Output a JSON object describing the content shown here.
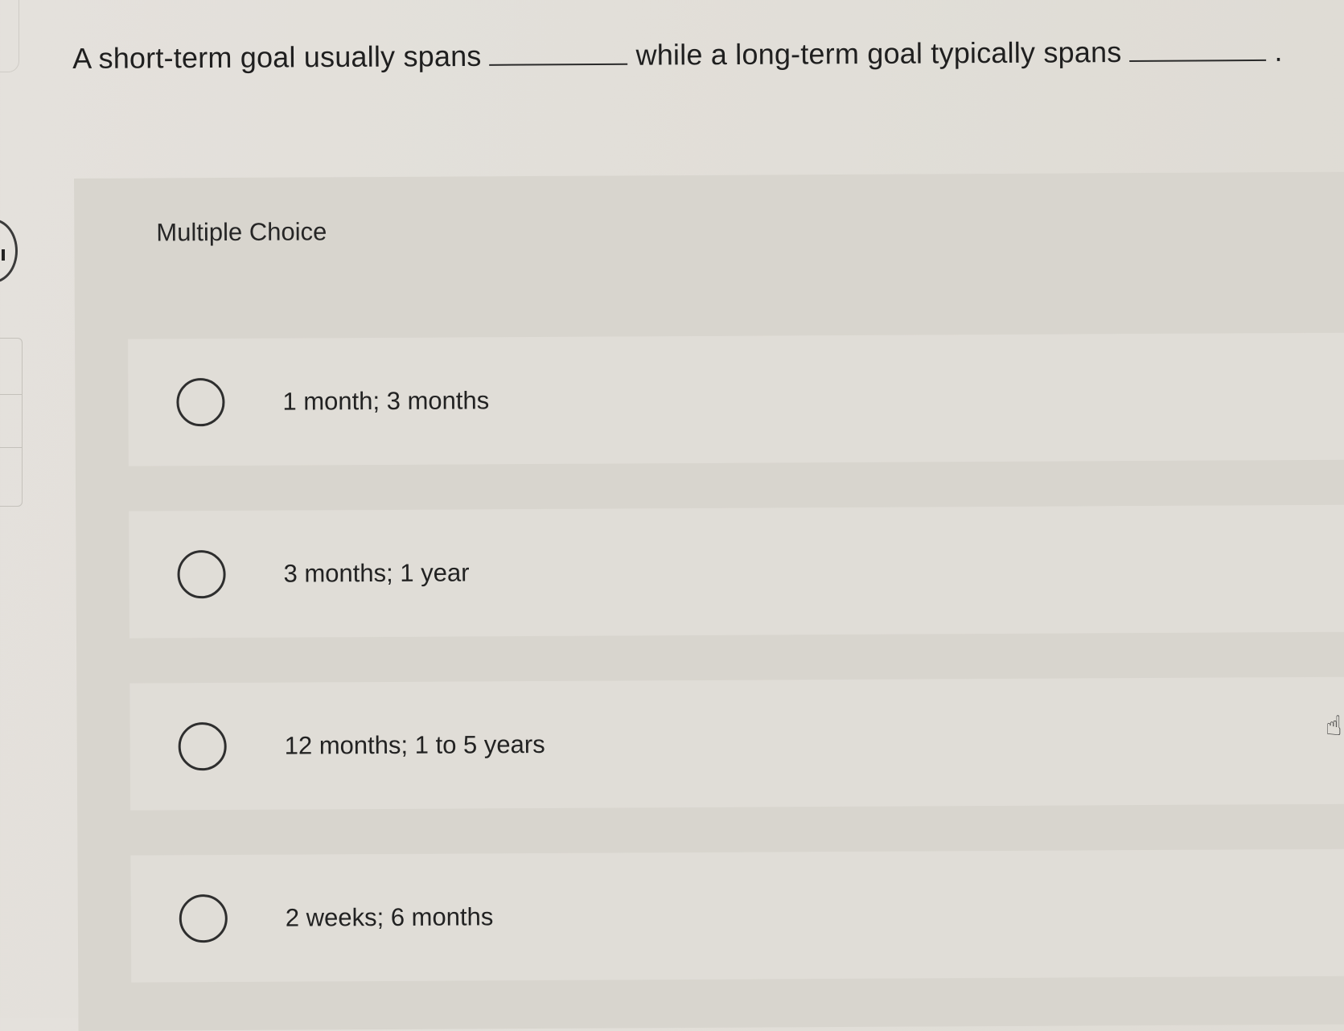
{
  "question": {
    "part1": "A short-term goal usually spans",
    "part2": "while a long-term goal typically spans",
    "end": "."
  },
  "section_label": "Multiple Choice",
  "options": [
    {
      "label": "1 month; 3 months",
      "selected": false
    },
    {
      "label": "3 months; 1 year",
      "selected": false
    },
    {
      "label": "12 months; 1 to 5 years",
      "selected": false
    },
    {
      "label": "2 weeks; 6 months",
      "selected": false
    }
  ],
  "icons": {
    "radio": "radio-unchecked-icon",
    "cursor": "hand-pointer-icon"
  },
  "colors": {
    "page_background": "#e2dfd9",
    "panel_background": "#d8d5ce",
    "option_background": "#e0ddd7",
    "text": "#1f1f1f"
  }
}
